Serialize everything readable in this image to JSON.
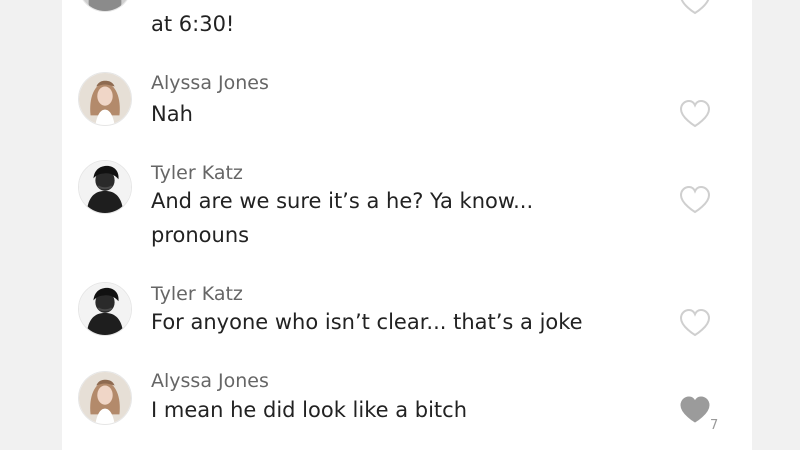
{
  "comments": [
    {
      "author": "",
      "text": "at 6:30!",
      "liked": false,
      "avatar": "partial-avatar"
    },
    {
      "author": "Alyssa Jones",
      "text": "Nah",
      "liked": false,
      "avatar": "alyssa-avatar"
    },
    {
      "author": "Tyler Katz",
      "text": "And are we sure it’s a he? Ya know...",
      "text_line2": "pronouns",
      "liked": false,
      "avatar": "tyler-avatar"
    },
    {
      "author": "Tyler Katz",
      "text": "For anyone who isn’t clear... that’s a joke",
      "liked": false,
      "avatar": "tyler-avatar"
    },
    {
      "author": "Alyssa Jones",
      "text": "I mean he did look like a bitch",
      "liked": true,
      "like_count": "7",
      "avatar": "alyssa-avatar"
    }
  ],
  "colors": {
    "page_bg": "#f1f1f1",
    "panel_bg": "#ffffff",
    "name": "#666666",
    "text": "#222222",
    "heart_outline": "#cfcfcf",
    "heart_filled": "#9b9b9b",
    "like_count": "#9a9a9a"
  }
}
